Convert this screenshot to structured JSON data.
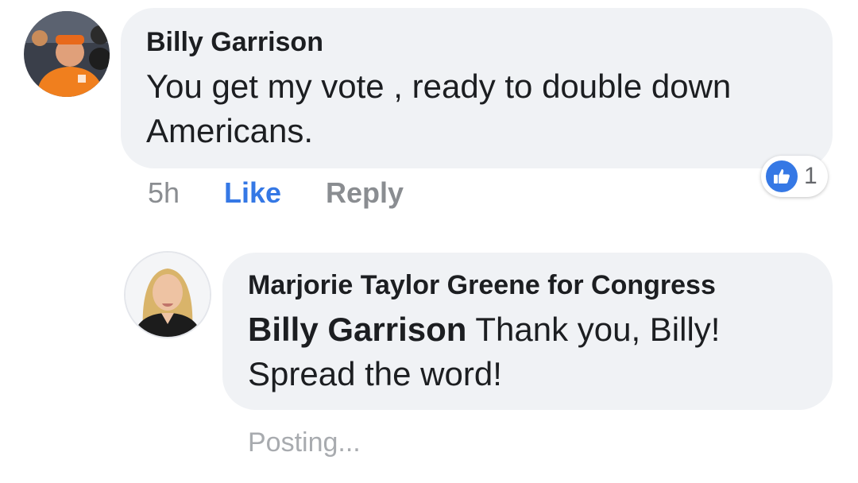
{
  "comment": {
    "author": "Billy Garrison",
    "text_line1": "You get my vote , ready to double down",
    "text_line2": "Americans.",
    "timestamp": "5h",
    "like_label": "Like",
    "reply_label": "Reply",
    "reaction_icon": "thumbs-up-icon",
    "reaction_count": "1"
  },
  "reply": {
    "author": "Marjorie Taylor Greene for Congress",
    "mention": "Billy Garrison",
    "text_line1_rest": " Thank you, Billy!",
    "text_line2": "Spread the word!",
    "status": "Posting..."
  },
  "colors": {
    "bubble": "#f0f2f5",
    "like_blue": "#3578e5",
    "secondary_text": "#8a8d91"
  }
}
